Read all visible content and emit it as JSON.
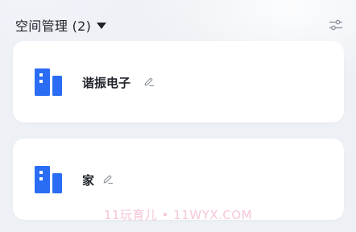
{
  "header": {
    "title": "空间管理 (2)",
    "caret_icon": "caret-down-icon",
    "filter_icon": "sliders-icon"
  },
  "spaces": [
    {
      "name": "谐振电子",
      "icon": "building-icon",
      "edit_icon": "pencil-icon"
    },
    {
      "name": "家",
      "icon": "building-icon",
      "edit_icon": "pencil-icon"
    }
  ],
  "watermark": "11玩育儿 • 11WYX.COM",
  "colors": {
    "accent": "#2a6df4",
    "background": "#edf0f5",
    "card": "#ffffff",
    "text": "#1f2329",
    "icon_muted": "#8a8f99",
    "watermark": "#ec96be"
  }
}
